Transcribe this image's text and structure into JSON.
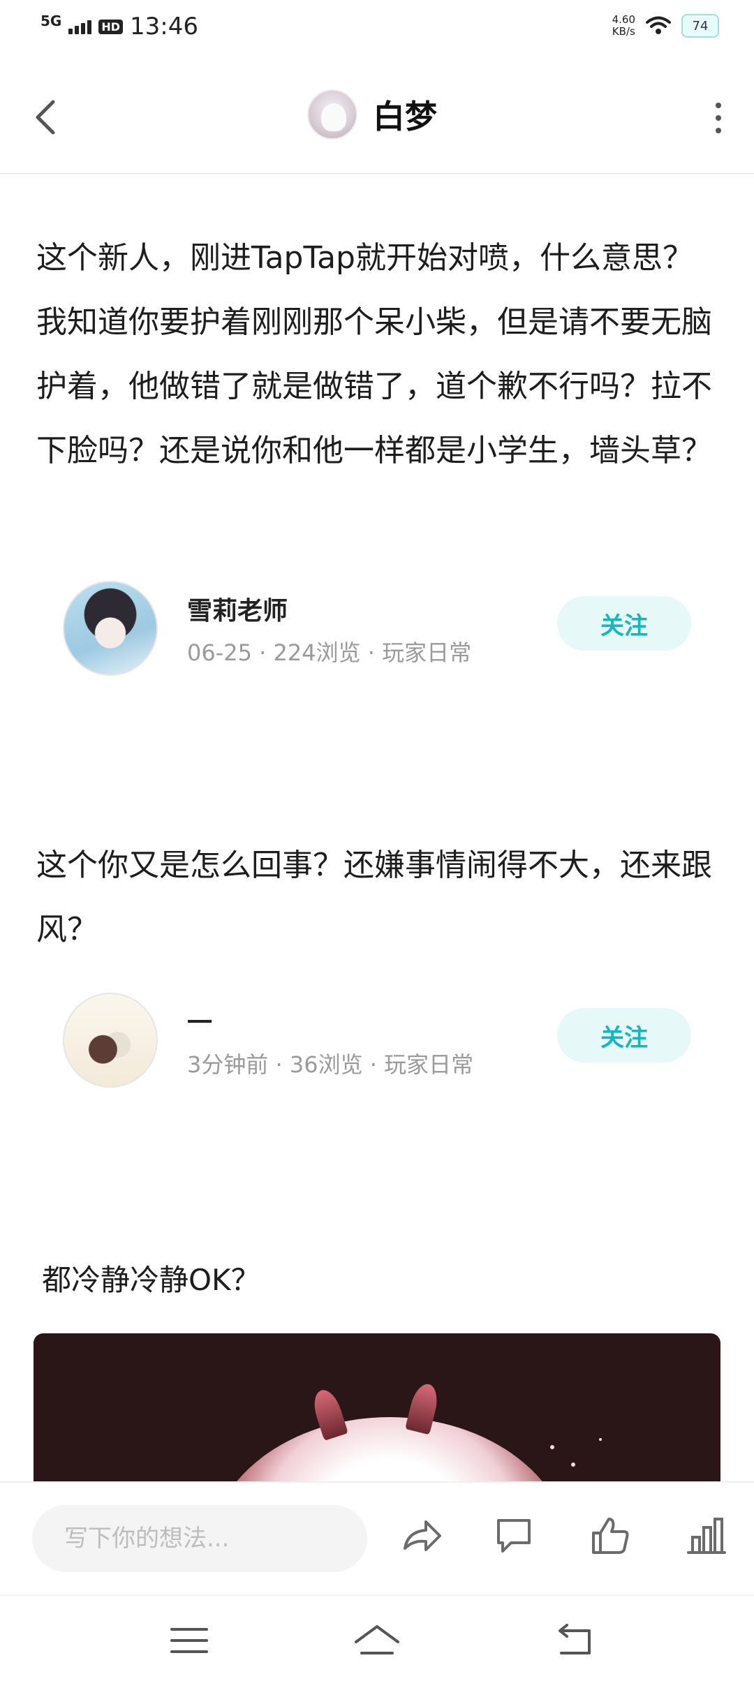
{
  "status_bar": {
    "network": "5G",
    "hd": "HD",
    "time": "13:46",
    "speed_value": "4.60",
    "speed_unit": "KB/s",
    "battery": "74"
  },
  "header": {
    "title": "白梦"
  },
  "posts": [
    {
      "text": "这个新人，刚进TapTap就开始对喷，什么意思？我知道你要护着刚刚那个呆小柴，但是请不要无脑护着，他做错了就是做错了，道个歉不行吗？拉不下脸吗？还是说你和他一样都是小学生，墙头草？",
      "author": "雪莉老师",
      "meta": "06-25 · 224浏览 · 玩家日常",
      "follow_label": "关注"
    },
    {
      "text": "这个你又是怎么回事？还嫌事情闹得不大，还来跟风？",
      "author": "一",
      "meta": "3分钟前 · 36浏览 · 玩家日常",
      "follow_label": "关注"
    }
  ],
  "closing_text": "都冷静冷静OK？",
  "bottom_bar": {
    "comment_placeholder": "写下你的想法..."
  },
  "icons": {
    "back": "back-arrow-icon",
    "more": "more-vertical-icon",
    "share": "share-icon",
    "comment": "comment-icon",
    "like": "thumbs-up-icon",
    "stats": "stats-icon",
    "menu": "menu-icon",
    "home": "home-icon",
    "nav_back": "nav-back-icon"
  },
  "colors": {
    "accent": "#17b5bf",
    "follow_bg": "#e6f8f8",
    "meta_text": "#9a9a9a"
  }
}
